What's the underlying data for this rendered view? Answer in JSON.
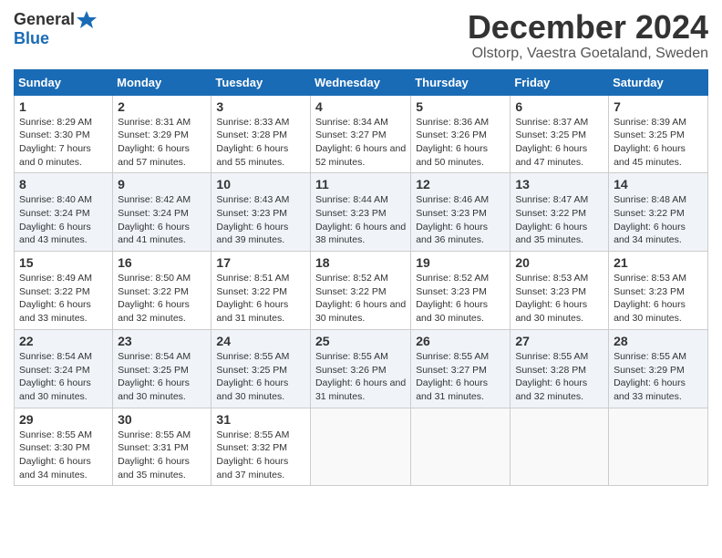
{
  "logo": {
    "general": "General",
    "blue": "Blue"
  },
  "title": "December 2024",
  "subtitle": "Olstorp, Vaestra Goetaland, Sweden",
  "days_header": [
    "Sunday",
    "Monday",
    "Tuesday",
    "Wednesday",
    "Thursday",
    "Friday",
    "Saturday"
  ],
  "weeks": [
    [
      {
        "day": "1",
        "sunrise": "8:29 AM",
        "sunset": "3:30 PM",
        "daylight": "7 hours and 0 minutes."
      },
      {
        "day": "2",
        "sunrise": "8:31 AM",
        "sunset": "3:29 PM",
        "daylight": "6 hours and 57 minutes."
      },
      {
        "day": "3",
        "sunrise": "8:33 AM",
        "sunset": "3:28 PM",
        "daylight": "6 hours and 55 minutes."
      },
      {
        "day": "4",
        "sunrise": "8:34 AM",
        "sunset": "3:27 PM",
        "daylight": "6 hours and 52 minutes."
      },
      {
        "day": "5",
        "sunrise": "8:36 AM",
        "sunset": "3:26 PM",
        "daylight": "6 hours and 50 minutes."
      },
      {
        "day": "6",
        "sunrise": "8:37 AM",
        "sunset": "3:25 PM",
        "daylight": "6 hours and 47 minutes."
      },
      {
        "day": "7",
        "sunrise": "8:39 AM",
        "sunset": "3:25 PM",
        "daylight": "6 hours and 45 minutes."
      }
    ],
    [
      {
        "day": "8",
        "sunrise": "8:40 AM",
        "sunset": "3:24 PM",
        "daylight": "6 hours and 43 minutes."
      },
      {
        "day": "9",
        "sunrise": "8:42 AM",
        "sunset": "3:24 PM",
        "daylight": "6 hours and 41 minutes."
      },
      {
        "day": "10",
        "sunrise": "8:43 AM",
        "sunset": "3:23 PM",
        "daylight": "6 hours and 39 minutes."
      },
      {
        "day": "11",
        "sunrise": "8:44 AM",
        "sunset": "3:23 PM",
        "daylight": "6 hours and 38 minutes."
      },
      {
        "day": "12",
        "sunrise": "8:46 AM",
        "sunset": "3:23 PM",
        "daylight": "6 hours and 36 minutes."
      },
      {
        "day": "13",
        "sunrise": "8:47 AM",
        "sunset": "3:22 PM",
        "daylight": "6 hours and 35 minutes."
      },
      {
        "day": "14",
        "sunrise": "8:48 AM",
        "sunset": "3:22 PM",
        "daylight": "6 hours and 34 minutes."
      }
    ],
    [
      {
        "day": "15",
        "sunrise": "8:49 AM",
        "sunset": "3:22 PM",
        "daylight": "6 hours and 33 minutes."
      },
      {
        "day": "16",
        "sunrise": "8:50 AM",
        "sunset": "3:22 PM",
        "daylight": "6 hours and 32 minutes."
      },
      {
        "day": "17",
        "sunrise": "8:51 AM",
        "sunset": "3:22 PM",
        "daylight": "6 hours and 31 minutes."
      },
      {
        "day": "18",
        "sunrise": "8:52 AM",
        "sunset": "3:22 PM",
        "daylight": "6 hours and 30 minutes."
      },
      {
        "day": "19",
        "sunrise": "8:52 AM",
        "sunset": "3:23 PM",
        "daylight": "6 hours and 30 minutes."
      },
      {
        "day": "20",
        "sunrise": "8:53 AM",
        "sunset": "3:23 PM",
        "daylight": "6 hours and 30 minutes."
      },
      {
        "day": "21",
        "sunrise": "8:53 AM",
        "sunset": "3:23 PM",
        "daylight": "6 hours and 30 minutes."
      }
    ],
    [
      {
        "day": "22",
        "sunrise": "8:54 AM",
        "sunset": "3:24 PM",
        "daylight": "6 hours and 30 minutes."
      },
      {
        "day": "23",
        "sunrise": "8:54 AM",
        "sunset": "3:25 PM",
        "daylight": "6 hours and 30 minutes."
      },
      {
        "day": "24",
        "sunrise": "8:55 AM",
        "sunset": "3:25 PM",
        "daylight": "6 hours and 30 minutes."
      },
      {
        "day": "25",
        "sunrise": "8:55 AM",
        "sunset": "3:26 PM",
        "daylight": "6 hours and 31 minutes."
      },
      {
        "day": "26",
        "sunrise": "8:55 AM",
        "sunset": "3:27 PM",
        "daylight": "6 hours and 31 minutes."
      },
      {
        "day": "27",
        "sunrise": "8:55 AM",
        "sunset": "3:28 PM",
        "daylight": "6 hours and 32 minutes."
      },
      {
        "day": "28",
        "sunrise": "8:55 AM",
        "sunset": "3:29 PM",
        "daylight": "6 hours and 33 minutes."
      }
    ],
    [
      {
        "day": "29",
        "sunrise": "8:55 AM",
        "sunset": "3:30 PM",
        "daylight": "6 hours and 34 minutes."
      },
      {
        "day": "30",
        "sunrise": "8:55 AM",
        "sunset": "3:31 PM",
        "daylight": "6 hours and 35 minutes."
      },
      {
        "day": "31",
        "sunrise": "8:55 AM",
        "sunset": "3:32 PM",
        "daylight": "6 hours and 37 minutes."
      },
      null,
      null,
      null,
      null
    ]
  ],
  "labels": {
    "sunrise": "Sunrise: ",
    "sunset": "Sunset: ",
    "daylight": "Daylight: "
  }
}
